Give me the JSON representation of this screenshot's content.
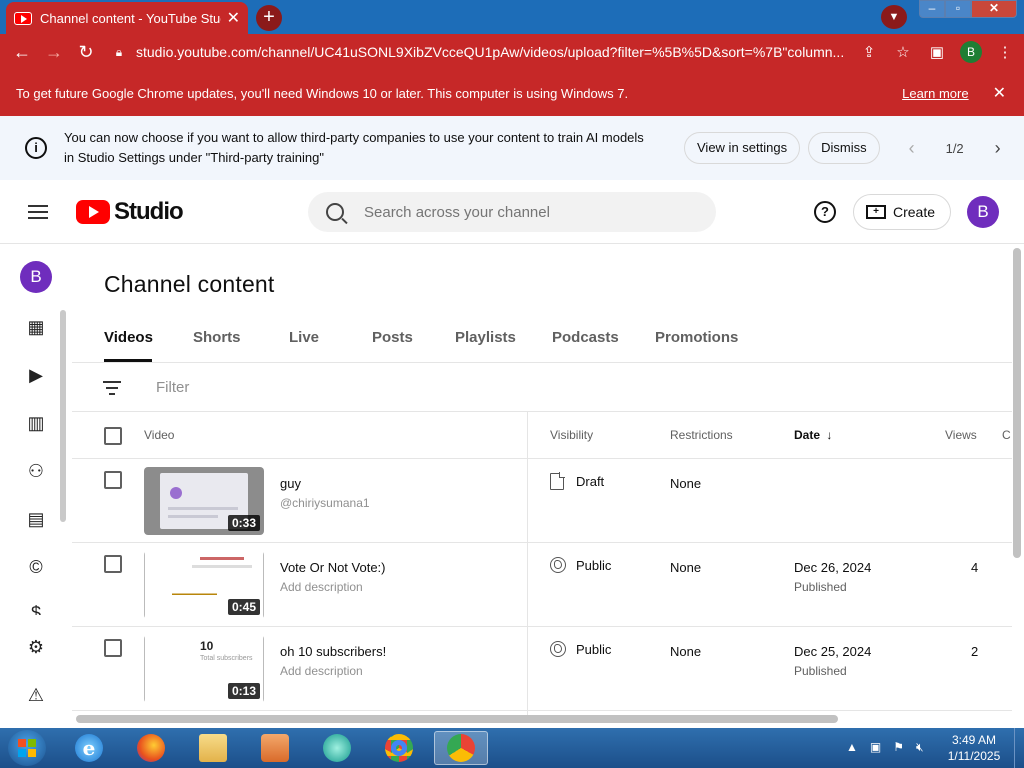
{
  "browser": {
    "tab_title": "Channel content - YouTube Studio",
    "tab_close": "✕",
    "new_tab": "+",
    "url": "studio.youtube.com/channel/UC41uSONL9XibZVcceQU1pAw/videos/upload?filter=%5B%5D&sort=%7B\"column...",
    "profile_initial": "B",
    "update_message": "To get future Google Chrome updates, you'll need Windows 10 or later. This computer is using Windows 7.",
    "learn_more": "Learn more",
    "update_close": "✕"
  },
  "notice": {
    "text_line1": "You can now choose if you want to allow third-party companies to use your content to train AI models",
    "text_line2": "in Studio Settings under \"Third-party training\"",
    "view_settings": "View in settings",
    "dismiss": "Dismiss",
    "page": "1/2"
  },
  "header": {
    "logo_text": "Studio",
    "search_placeholder": "Search across your channel",
    "create_label": "Create",
    "avatar_initial": "B"
  },
  "rail": {
    "avatar_initial": "B",
    "items": [
      "dashboard-icon",
      "content-icon",
      "analytics-icon",
      "community-icon",
      "subtitles-icon",
      "copyright-icon",
      "earn-icon",
      "settings-icon",
      "feedback-icon"
    ]
  },
  "main": {
    "title": "Channel content",
    "tabs": [
      "Videos",
      "Shorts",
      "Live",
      "Posts",
      "Playlists",
      "Podcasts",
      "Promotions"
    ],
    "active_tab": "Videos",
    "filter_placeholder": "Filter",
    "columns": {
      "video": "Video",
      "visibility": "Visibility",
      "restrictions": "Restrictions",
      "date": "Date",
      "views": "Views",
      "comments": "C"
    },
    "rows": [
      {
        "title": "guy",
        "subtitle": "@chiriysumana1",
        "duration": "0:33",
        "visibility": "Draft",
        "restrictions": "None",
        "date": "",
        "date_status": "",
        "views": ""
      },
      {
        "title": "Vote Or Not Vote:)",
        "subtitle": "Add description",
        "duration": "0:45",
        "visibility": "Public",
        "restrictions": "None",
        "date": "Dec 26, 2024",
        "date_status": "Published",
        "views": "4"
      },
      {
        "title": "oh 10 subscribers!",
        "subtitle": "Add description",
        "duration": "0:13",
        "visibility": "Public",
        "restrictions": "None",
        "date": "Dec 25, 2024",
        "date_status": "Published",
        "views": "2"
      }
    ],
    "thumb3_number": "10",
    "thumb3_label": "Total subscribers"
  },
  "taskbar": {
    "apps": [
      "internet-explorer",
      "firefox",
      "file-explorer",
      "media-player",
      "app-green",
      "chrome",
      "chrome-profile-b"
    ],
    "time": "3:49 AM",
    "date": "1/11/2025"
  },
  "colors": {
    "chrome_red": "#c62828",
    "titlebar_blue": "#1d6db8",
    "studio_red": "#ff0000",
    "avatar_purple": "#6f2dbd"
  }
}
